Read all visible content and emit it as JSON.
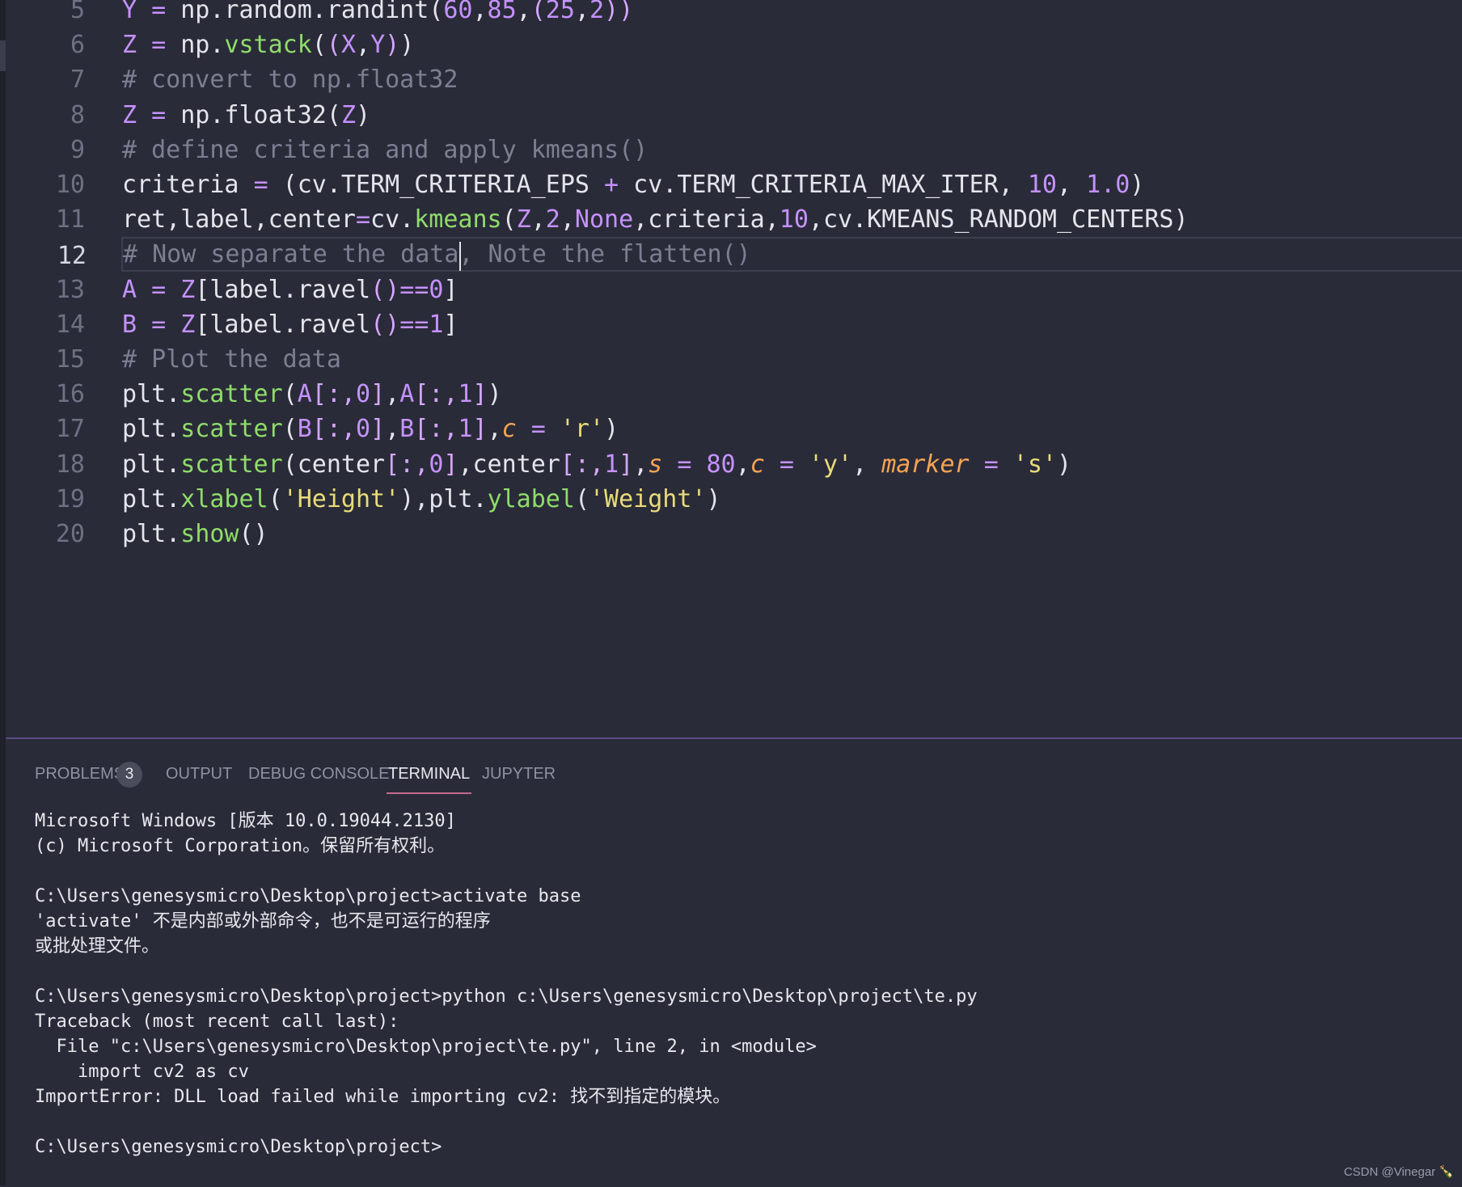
{
  "editor": {
    "lines": [
      {
        "n": "5",
        "tokens": [
          [
            "pu",
            "Y"
          ],
          [
            "",
            " "
          ],
          [
            "pu",
            "="
          ],
          [
            "",
            " np.random.randint("
          ],
          [
            "pu",
            "60"
          ],
          [
            "",
            ","
          ],
          [
            "pu",
            "85"
          ],
          [
            "",
            ","
          ],
          [
            "pk",
            "("
          ],
          [
            "pu",
            "25"
          ],
          [
            "",
            ","
          ],
          [
            "pu",
            "2"
          ],
          [
            "pk",
            "))"
          ]
        ]
      },
      {
        "n": "6",
        "tokens": [
          [
            "pu",
            "Z"
          ],
          [
            "",
            " "
          ],
          [
            "pu",
            "="
          ],
          [
            "",
            " np."
          ],
          [
            "gr",
            "vstack"
          ],
          [
            "",
            "("
          ],
          [
            "pk",
            "("
          ],
          [
            "pu",
            "X"
          ],
          [
            "",
            ","
          ],
          [
            "pu",
            "Y"
          ],
          [
            "pk",
            ")"
          ],
          [
            "",
            ")"
          ]
        ]
      },
      {
        "n": "7",
        "tokens": [
          [
            "cm",
            "# convert to np.float32"
          ]
        ]
      },
      {
        "n": "8",
        "tokens": [
          [
            "pu",
            "Z"
          ],
          [
            "",
            " "
          ],
          [
            "pu",
            "="
          ],
          [
            "",
            " np.float32("
          ],
          [
            "pu",
            "Z"
          ],
          [
            "",
            ")"
          ]
        ]
      },
      {
        "n": "9",
        "tokens": [
          [
            "cm",
            "# define criteria and apply kmeans()"
          ]
        ]
      },
      {
        "n": "10",
        "tokens": [
          [
            "",
            "criteria "
          ],
          [
            "pu",
            "="
          ],
          [
            "",
            " (cv.TERM_CRITERIA_EPS "
          ],
          [
            "pu",
            "+"
          ],
          [
            "",
            " cv.TERM_CRITERIA_MAX_ITER, "
          ],
          [
            "pu",
            "10"
          ],
          [
            "",
            ", "
          ],
          [
            "pu",
            "1.0"
          ],
          [
            "",
            ")"
          ]
        ]
      },
      {
        "n": "11",
        "tokens": [
          [
            "",
            "ret,label,center"
          ],
          [
            "pu",
            "="
          ],
          [
            "",
            "cv."
          ],
          [
            "gr",
            "kmeans"
          ],
          [
            "",
            "("
          ],
          [
            "pu",
            "Z"
          ],
          [
            "",
            ","
          ],
          [
            "pu",
            "2"
          ],
          [
            "",
            ","
          ],
          [
            "pu",
            "None"
          ],
          [
            "",
            ",criteria,"
          ],
          [
            "pu",
            "10"
          ],
          [
            "",
            ",cv.KMEANS_RANDOM_CENTERS)"
          ]
        ]
      },
      {
        "n": "12",
        "tokens": [
          [
            "cm",
            "# Now separate the data, Note the flatten()"
          ]
        ]
      },
      {
        "n": "13",
        "tokens": [
          [
            "pu",
            "A"
          ],
          [
            "",
            " "
          ],
          [
            "pu",
            "="
          ],
          [
            "",
            " "
          ],
          [
            "pu",
            "Z"
          ],
          [
            "",
            "[label.ravel"
          ],
          [
            "pk",
            "()"
          ],
          [
            "pu",
            "=="
          ],
          [
            "pu",
            "0"
          ],
          [
            "",
            "]"
          ]
        ]
      },
      {
        "n": "14",
        "tokens": [
          [
            "pu",
            "B"
          ],
          [
            "",
            " "
          ],
          [
            "pu",
            "="
          ],
          [
            "",
            " "
          ],
          [
            "pu",
            "Z"
          ],
          [
            "",
            "[label.ravel"
          ],
          [
            "pk",
            "()"
          ],
          [
            "pu",
            "=="
          ],
          [
            "pu",
            "1"
          ],
          [
            "",
            "]"
          ]
        ]
      },
      {
        "n": "15",
        "tokens": [
          [
            "cm",
            "# Plot the data"
          ]
        ]
      },
      {
        "n": "16",
        "tokens": [
          [
            "",
            "plt."
          ],
          [
            "gr",
            "scatter"
          ],
          [
            "",
            "("
          ],
          [
            "pu",
            "A"
          ],
          [
            "pk",
            "[:,"
          ],
          [
            "pu",
            "0"
          ],
          [
            "pk",
            "]"
          ],
          [
            "",
            ","
          ],
          [
            "pu",
            "A"
          ],
          [
            "pk",
            "[:,"
          ],
          [
            "pu",
            "1"
          ],
          [
            "pk",
            "]"
          ],
          [
            "",
            ")"
          ]
        ]
      },
      {
        "n": "17",
        "tokens": [
          [
            "",
            "plt."
          ],
          [
            "gr",
            "scatter"
          ],
          [
            "",
            "("
          ],
          [
            "pu",
            "B"
          ],
          [
            "pk",
            "[:,"
          ],
          [
            "pu",
            "0"
          ],
          [
            "pk",
            "]"
          ],
          [
            "",
            ","
          ],
          [
            "pu",
            "B"
          ],
          [
            "pk",
            "[:,"
          ],
          [
            "pu",
            "1"
          ],
          [
            "pk",
            "]"
          ],
          [
            "",
            ","
          ],
          [
            "or",
            "c"
          ],
          [
            "",
            " "
          ],
          [
            "pu",
            "="
          ],
          [
            "",
            " "
          ],
          [
            "ye",
            "'r'"
          ],
          [
            "",
            ")"
          ]
        ]
      },
      {
        "n": "18",
        "tokens": [
          [
            "",
            "plt."
          ],
          [
            "gr",
            "scatter"
          ],
          [
            "",
            "(center"
          ],
          [
            "pk",
            "[:,"
          ],
          [
            "pu",
            "0"
          ],
          [
            "pk",
            "]"
          ],
          [
            "",
            ",center"
          ],
          [
            "pk",
            "[:,"
          ],
          [
            "pu",
            "1"
          ],
          [
            "pk",
            "]"
          ],
          [
            "",
            ","
          ],
          [
            "or",
            "s"
          ],
          [
            "",
            " "
          ],
          [
            "pu",
            "="
          ],
          [
            "",
            " "
          ],
          [
            "pu",
            "80"
          ],
          [
            "",
            ","
          ],
          [
            "or",
            "c"
          ],
          [
            "",
            " "
          ],
          [
            "pu",
            "="
          ],
          [
            "",
            " "
          ],
          [
            "ye",
            "'y'"
          ],
          [
            "",
            ", "
          ],
          [
            "or",
            "marker"
          ],
          [
            "",
            " "
          ],
          [
            "pu",
            "="
          ],
          [
            "",
            " "
          ],
          [
            "ye",
            "'s'"
          ],
          [
            "",
            ")"
          ]
        ]
      },
      {
        "n": "19",
        "tokens": [
          [
            "",
            "plt."
          ],
          [
            "gr",
            "xlabel"
          ],
          [
            "",
            "("
          ],
          [
            "ye",
            "'Height'"
          ],
          [
            "",
            "),plt."
          ],
          [
            "gr",
            "ylabel"
          ],
          [
            "",
            "("
          ],
          [
            "ye",
            "'Weight'"
          ],
          [
            "",
            ")"
          ]
        ]
      },
      {
        "n": "20",
        "tokens": [
          [
            "",
            "plt."
          ],
          [
            "gr",
            "show"
          ],
          [
            "",
            "()"
          ]
        ]
      }
    ],
    "active_line": "12"
  },
  "panel": {
    "tabs": [
      {
        "label": "PROBLEMS",
        "badge": "3",
        "active": false
      },
      {
        "label": "OUTPUT",
        "active": false
      },
      {
        "label": "DEBUG CONSOLE",
        "active": false
      },
      {
        "label": "TERMINAL",
        "active": true
      },
      {
        "label": "JUPYTER",
        "active": false
      }
    ],
    "terminal_lines": [
      "Microsoft Windows [版本 10.0.19044.2130]",
      "(c) Microsoft Corporation。保留所有权利。",
      "",
      "C:\\Users\\genesysmicro\\Desktop\\project>activate base",
      "'activate' 不是内部或外部命令，也不是可运行的程序",
      "或批处理文件。",
      "",
      "C:\\Users\\genesysmicro\\Desktop\\project>python c:\\Users\\genesysmicro\\Desktop\\project\\te.py",
      "Traceback (most recent call last):",
      "  File \"c:\\Users\\genesysmicro\\Desktop\\project\\te.py\", line 2, in <module>",
      "    import cv2 as cv",
      "ImportError: DLL load failed while importing cv2: 找不到指定的模块。",
      "",
      "C:\\Users\\genesysmicro\\Desktop\\project>"
    ]
  },
  "watermark": "CSDN @Vinegar 🍾"
}
